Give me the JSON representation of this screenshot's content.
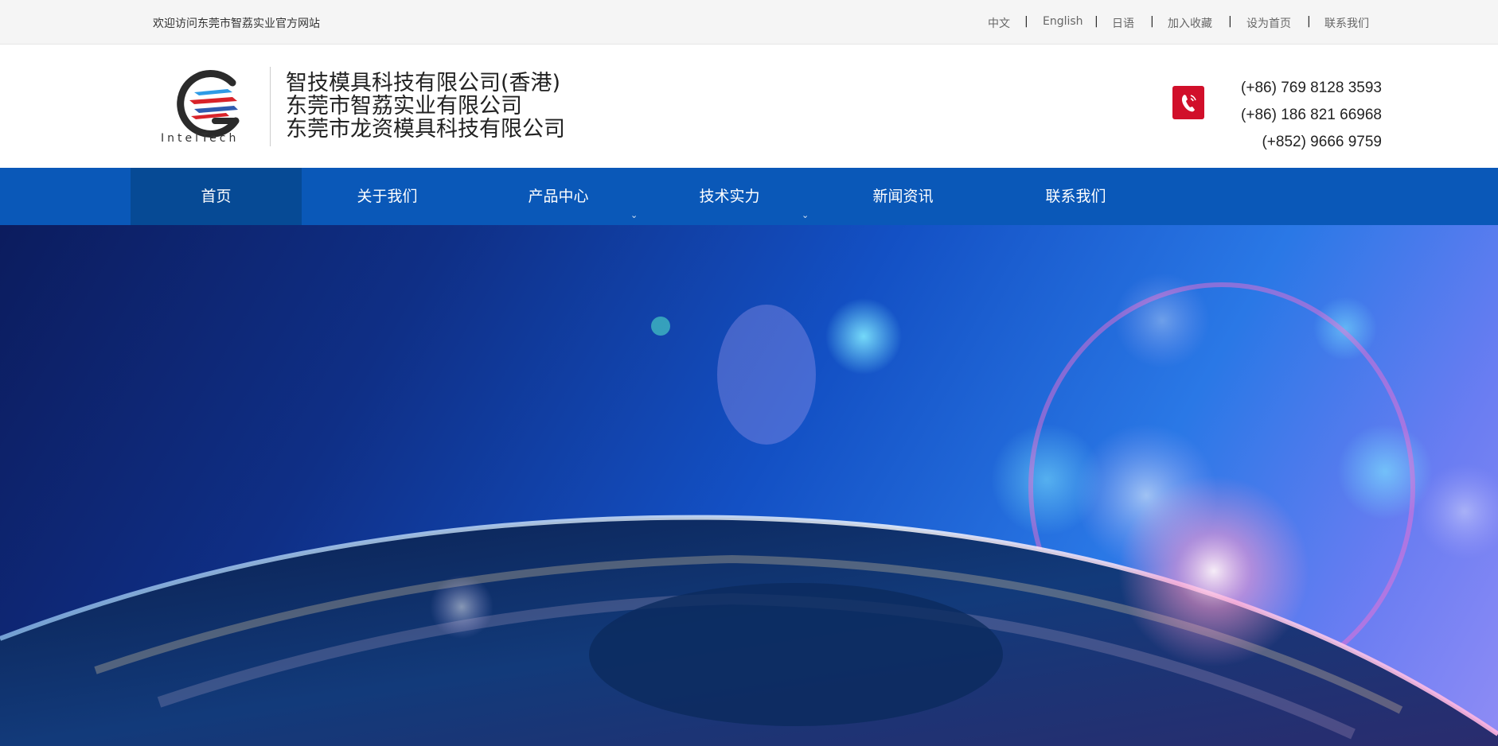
{
  "topbar": {
    "welcome": "欢迎访问东莞市智荔实业官方网站",
    "links": [
      "中文",
      "English",
      "日语",
      "加入收藏",
      "设为首页",
      "联系我们"
    ],
    "separator": "|"
  },
  "header": {
    "logo_text": "IntelTech",
    "company_names": [
      "智技模具科技有限公司(香港)",
      "东莞市智荔实业有限公司",
      "东莞市龙资模具科技有限公司"
    ],
    "phone_icon": "phone-icon",
    "phones": [
      "(+86)  769 8128 3593",
      "(+86)  186 821 66968",
      "(+852)   9666 9759"
    ]
  },
  "nav": {
    "items": [
      {
        "label": "首页",
        "active": true,
        "has_dropdown": false
      },
      {
        "label": "关于我们",
        "active": false,
        "has_dropdown": false
      },
      {
        "label": "产品中心",
        "active": false,
        "has_dropdown": true
      },
      {
        "label": "技术实力",
        "active": false,
        "has_dropdown": true
      },
      {
        "label": "新闻资讯",
        "active": false,
        "has_dropdown": false
      },
      {
        "label": "联系我们",
        "active": false,
        "has_dropdown": false
      }
    ],
    "dropdown_icon": "chevron-down-icon"
  },
  "banner": {
    "image": "city-globe-at-night-image"
  },
  "colors": {
    "nav_bg": "#0a58b8",
    "nav_active": "#064a95",
    "phone_icon_bg": "#d10f2a",
    "topbar_bg": "#f5f5f5"
  }
}
